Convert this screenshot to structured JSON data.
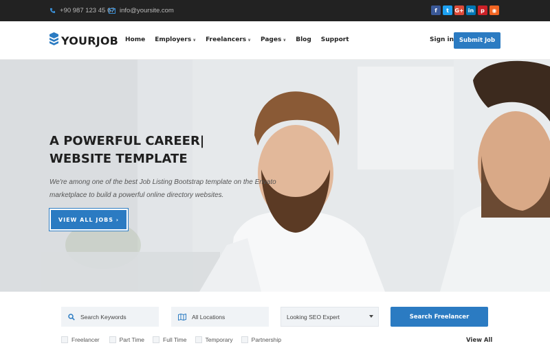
{
  "topbar": {
    "phone": "+90 987 123 45 67",
    "email": "info@yoursite.com",
    "icons": {
      "phone": "phone-icon",
      "email": "envelope-icon"
    },
    "social": [
      {
        "name": "facebook-icon",
        "glyph": "f",
        "color": "#3b5998"
      },
      {
        "name": "twitter-icon",
        "glyph": "t",
        "color": "#1da1f2"
      },
      {
        "name": "google-plus-icon",
        "glyph": "G+",
        "color": "#dd4b39"
      },
      {
        "name": "linkedin-icon",
        "glyph": "in",
        "color": "#0077b5"
      },
      {
        "name": "pinterest-icon",
        "glyph": "p",
        "color": "#cb2027"
      },
      {
        "name": "rss-icon",
        "glyph": "◉",
        "color": "#f26522"
      }
    ]
  },
  "header": {
    "logo": "YOURJOB",
    "nav": [
      {
        "label": "Home",
        "dropdown": false
      },
      {
        "label": "Employers",
        "dropdown": true
      },
      {
        "label": "Freelancers",
        "dropdown": true
      },
      {
        "label": "Pages",
        "dropdown": true
      },
      {
        "label": "Blog",
        "dropdown": false
      },
      {
        "label": "Support",
        "dropdown": false
      }
    ],
    "signin": "Sign in",
    "submit": "Submit Job"
  },
  "hero": {
    "title": "A POWERFUL CAREER|\nWEBSITE TEMPLATE",
    "description": "We're among one of the best Job Listing Bootstrap template on the Envato marketplace to build a powerful online directory websites.",
    "cta": "VIEW ALL JOBS ›"
  },
  "search": {
    "keywords_placeholder": "Search Keywords",
    "location_placeholder": "All Locations",
    "selected_option": "Looking SEO Expert",
    "button": "Search Freelancer",
    "filters": [
      "Freelancer",
      "Part Time",
      "Full Time",
      "Temporary",
      "Partnership"
    ],
    "view_all": "View All"
  },
  "colors": {
    "accent": "#2b7bc2",
    "topbar": "#222222"
  }
}
